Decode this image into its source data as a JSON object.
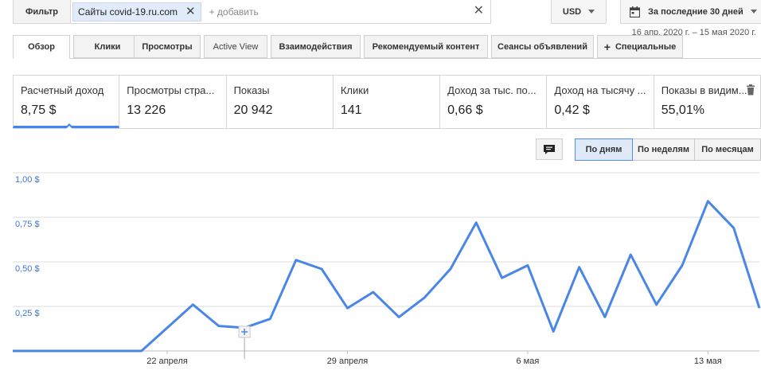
{
  "filter": {
    "label": "Фильтр",
    "chip": "Сайты covid-19.ru.com",
    "add": "+ добавить"
  },
  "currency": {
    "value": "USD"
  },
  "date_range": {
    "label": "За последние 30 дней",
    "sub": "16 апр. 2020 г. – 15 мая 2020 г."
  },
  "tabs": [
    {
      "label": "Обзор",
      "active": true
    },
    {
      "label": "Клики"
    },
    {
      "label": "Просмотры"
    },
    {
      "label": "Active View"
    },
    {
      "label": "Взаимодействия"
    },
    {
      "label": "Рекомендуемый контент"
    },
    {
      "label": "Сеансы объявлений"
    },
    {
      "label": "Специальные",
      "plus": "+"
    }
  ],
  "metrics": [
    {
      "label": "Расчетный доход",
      "value": "8,75 $",
      "selected": true
    },
    {
      "label": "Просмотры стра...",
      "value": "13 226"
    },
    {
      "label": "Показы",
      "value": "20 942"
    },
    {
      "label": "Клики",
      "value": "141"
    },
    {
      "label": "Доход за тыс. по...",
      "value": "0,66 $"
    },
    {
      "label": "Доход на тысячу ...",
      "value": "0,42 $"
    },
    {
      "label": "Показы в видим...",
      "value": "55,01%"
    }
  ],
  "period_buttons": [
    {
      "label": "По дням",
      "active": true
    },
    {
      "label": "По неделям"
    },
    {
      "label": "По месяцам"
    }
  ],
  "colors": {
    "accent": "#4285f4",
    "line": "#4a86e8",
    "axis_label": "#3d78d8"
  },
  "chart_data": {
    "type": "line",
    "x": [
      "16.04",
      "17.04",
      "18.04",
      "19.04",
      "20.04",
      "21.04",
      "22.04",
      "23.04",
      "24.04",
      "25.04",
      "26.04",
      "27.04",
      "28.04",
      "29.04",
      "30.04",
      "01.05",
      "02.05",
      "03.05",
      "04.05",
      "05.05",
      "06.05",
      "07.05",
      "08.05",
      "09.05",
      "10.05",
      "11.05",
      "12.05",
      "13.05",
      "14.05",
      "15.05"
    ],
    "series": [
      {
        "values": [
          0,
          0,
          0,
          0,
          0,
          0,
          0.13,
          0.26,
          0.14,
          0.13,
          0.18,
          0.51,
          0.46,
          0.24,
          0.33,
          0.19,
          0.3,
          0.46,
          0.72,
          0.41,
          0.48,
          0.11,
          0.47,
          0.19,
          0.54,
          0.26,
          0.48,
          0.84,
          0.69,
          0.24
        ]
      }
    ],
    "ylim": [
      0,
      1.0
    ],
    "yticks": [
      {
        "value": 0.25,
        "label": "0,25 $"
      },
      {
        "value": 0.5,
        "label": "0,50 $"
      },
      {
        "value": 0.75,
        "label": "0,75 $"
      },
      {
        "value": 1.0,
        "label": "1,00 $"
      }
    ],
    "xticks": [
      {
        "index": 6,
        "label": "22 апреля"
      },
      {
        "index": 13,
        "label": "29 апреля"
      },
      {
        "index": 20,
        "label": "6 мая"
      },
      {
        "index": 27,
        "label": "13 мая"
      }
    ],
    "annotation_index": 9,
    "grid": true
  }
}
